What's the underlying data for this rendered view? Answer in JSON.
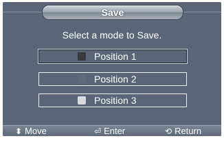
{
  "dialog": {
    "title": "Save",
    "prompt": "Select a mode to Save."
  },
  "options": [
    {
      "label": "Position 1",
      "swatch_color": "#3a3a3a",
      "selected": true
    },
    {
      "label": "Position 2",
      "swatch_color": "#5f6a7a",
      "selected": false
    },
    {
      "label": "Position 3",
      "swatch_color": "#d6dae0",
      "selected": false
    }
  ],
  "footer": {
    "move": {
      "label": "Move",
      "icon": "up-down-arrows-icon",
      "glyph": "⬍"
    },
    "enter": {
      "label": "Enter",
      "icon": "enter-icon",
      "glyph": "⏎"
    },
    "return": {
      "label": "Return",
      "icon": "return-icon",
      "glyph": "⟲"
    }
  },
  "colors": {
    "panel": "#5a6677",
    "text": "#ffffff"
  }
}
